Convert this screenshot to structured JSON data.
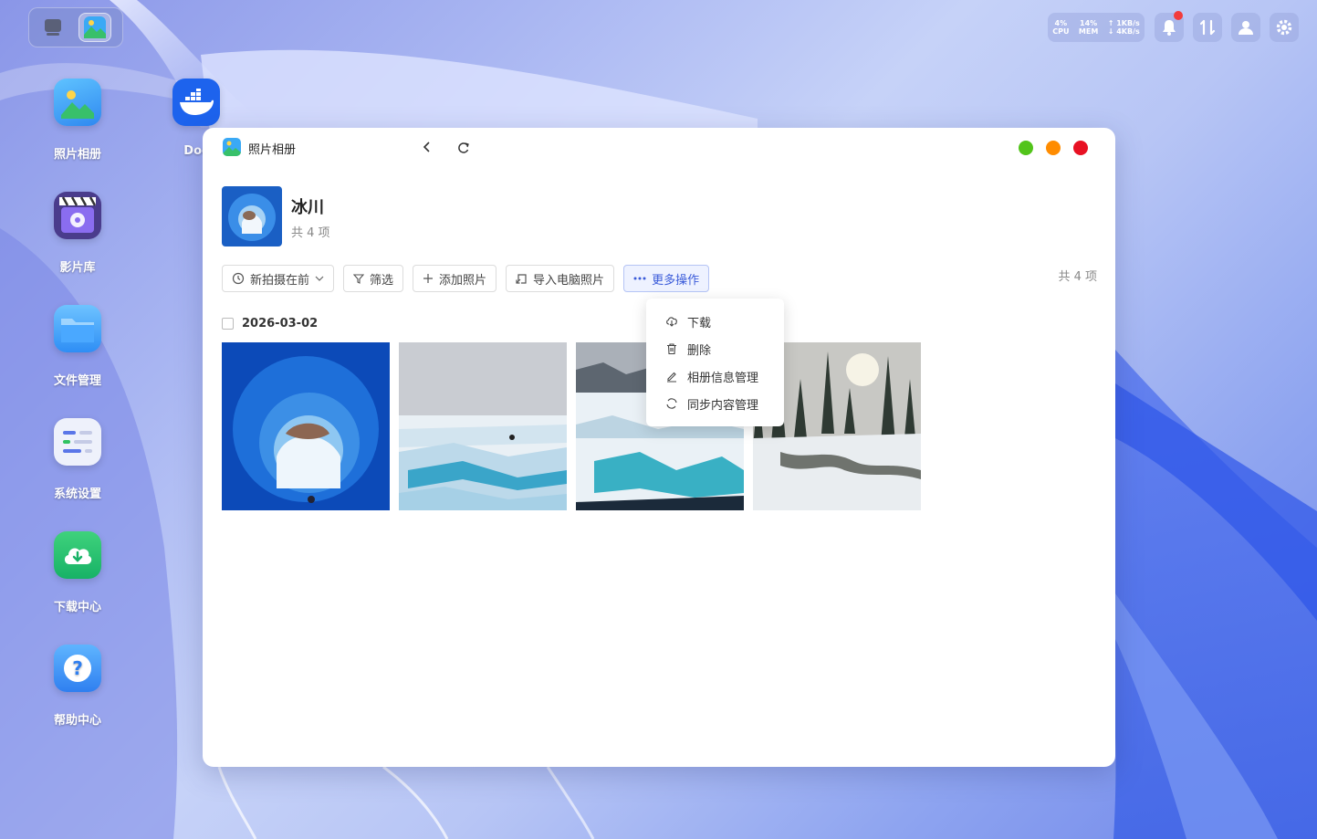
{
  "desktop": {
    "icons": [
      {
        "label": "照片相册",
        "icon": "photo-album-icon"
      },
      {
        "label": "影片库",
        "icon": "movie-library-icon"
      },
      {
        "label": "文件管理",
        "icon": "folder-icon"
      },
      {
        "label": "系统设置",
        "icon": "settings-sliders-icon"
      },
      {
        "label": "下载中心",
        "icon": "cloud-download-icon"
      },
      {
        "label": "帮助中心",
        "icon": "help-icon"
      },
      {
        "label": "Doc",
        "icon": "docker-icon"
      }
    ]
  },
  "status": {
    "cpu_value": "4%",
    "cpu_label": "CPU",
    "mem_value": "14%",
    "mem_label": "MEM",
    "net_up": "↑ 1KB/s",
    "net_down": "↓ 4KB/s"
  },
  "window": {
    "title": "照片相册",
    "album": {
      "name": "冰川",
      "count": "共 4 项"
    },
    "toolbar": {
      "sort": "新拍摄在前",
      "filter": "筛选",
      "add": "添加照片",
      "import": "导入电脑照片",
      "more": "更多操作"
    },
    "total": "共 4 项",
    "date": "2026-03-02",
    "menu": [
      "下载",
      "删除",
      "相册信息管理",
      "同步内容管理"
    ],
    "colors": {
      "close": "#e81123",
      "minimize": "#ff8c00",
      "maximize": "#52c41a",
      "accent": "#3a5bd9"
    }
  }
}
